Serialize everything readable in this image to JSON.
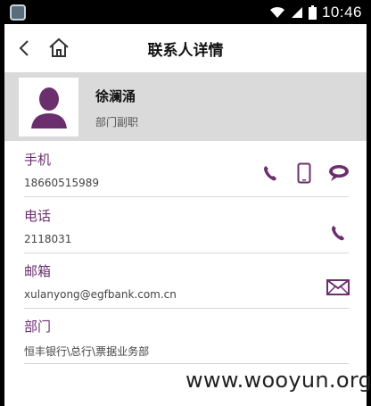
{
  "status_bar": {
    "time": "10:46"
  },
  "header": {
    "title": "联系人详情"
  },
  "profile": {
    "name": "徐澜涌",
    "title": "部门副职"
  },
  "fields": [
    {
      "label": "手机",
      "value": "18660515989"
    },
    {
      "label": "电话",
      "value": "2118031"
    },
    {
      "label": "邮箱",
      "value": "xulanyong@egfbank.com.cn"
    },
    {
      "label": "部门",
      "value": "恒丰银行\\总行\\票据业务部"
    }
  ],
  "watermark": "www.wooyun.org",
  "colors": {
    "accent": "#6b2f6e",
    "profile_bg": "#dadada",
    "avatar": "#6b2f6e"
  },
  "icons": [
    "back-icon",
    "home-icon",
    "phone-call-icon",
    "mobile-icon",
    "chat-bubble-icon",
    "envelope-icon"
  ]
}
